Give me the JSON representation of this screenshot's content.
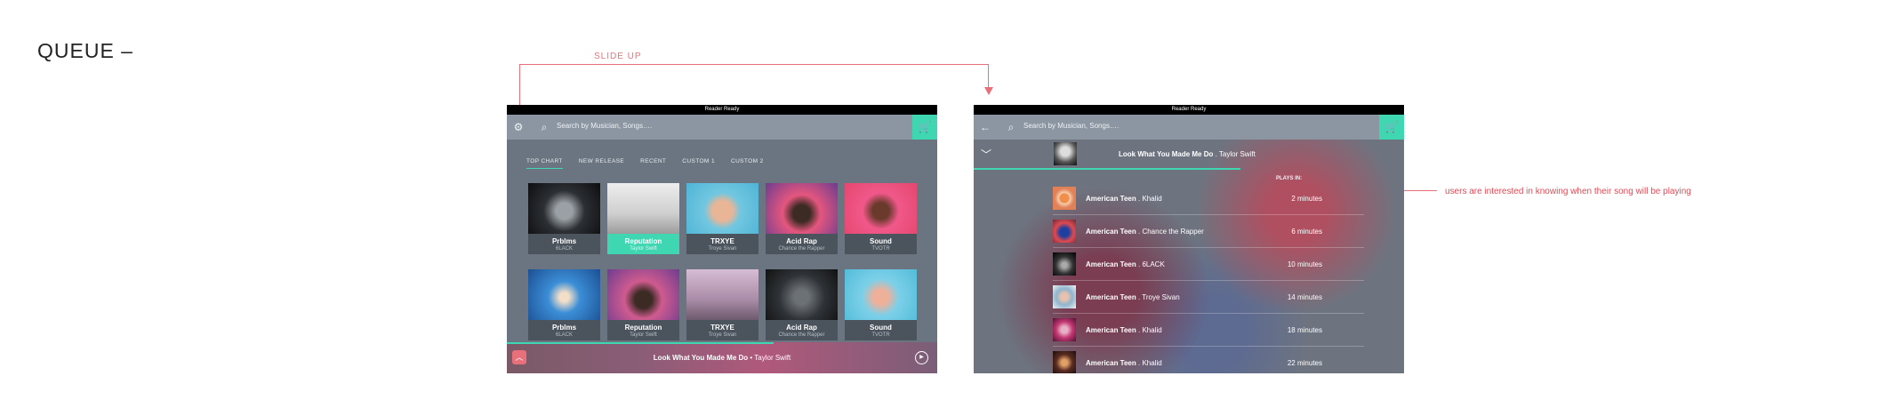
{
  "page": {
    "title": "QUEUE –"
  },
  "annotations": {
    "slide_up": "SLIDE UP",
    "note": "users are interested in knowing when their song will be playing"
  },
  "colors": {
    "accent": "#3fd6b2",
    "annotation": "#e8707a",
    "screen_bg": "#6b7581"
  },
  "left_screen": {
    "status": "Reader Ready",
    "search_placeholder": "Search by Musician, Songs….",
    "icons": {
      "settings": "gear-icon",
      "search": "search-icon",
      "cart": "cart-icon"
    },
    "tabs": [
      {
        "label": "TOP CHART",
        "active": true
      },
      {
        "label": "NEW RELEASE"
      },
      {
        "label": "RECENT"
      },
      {
        "label": "CUSTOM 1"
      },
      {
        "label": "CUSTOM 2"
      }
    ],
    "albums": [
      {
        "title": "Prblms",
        "artist": "6LACK"
      },
      {
        "title": "Reputation",
        "artist": "Taylor Swift",
        "selected": true
      },
      {
        "title": "TRXYE",
        "artist": "Troye Sivan"
      },
      {
        "title": "Acid Rap",
        "artist": "Chance the Rapper"
      },
      {
        "title": "Sound",
        "artist": "TVOTR"
      },
      {
        "title": "Prblms",
        "artist": "6LACK"
      },
      {
        "title": "Reputation",
        "artist": "Taylor Swift"
      },
      {
        "title": "TRXYE",
        "artist": "Troye Sivan"
      },
      {
        "title": "Acid Rap",
        "artist": "Chance the Rapper"
      },
      {
        "title": "Sound",
        "artist": "TVOTR"
      }
    ],
    "now_playing": {
      "song": "Look What You Made Me Do",
      "separator": " • ",
      "artist": "Taylor Swift"
    }
  },
  "right_screen": {
    "status": "Reader Ready",
    "search_placeholder": "Search by Musician, Songs….",
    "now_playing": {
      "song": "Look What You Made Me Do",
      "separator": " . ",
      "artist": "Taylor Swift"
    },
    "plays_in_label": "PLAYS IN:",
    "queue": [
      {
        "song": "American Teen",
        "artist": "Khalid",
        "time": "2 minutes"
      },
      {
        "song": "American Teen",
        "artist": "Chance the Rapper",
        "time": "6 minutes"
      },
      {
        "song": "American Teen",
        "artist": "6LACK",
        "time": "10 minutes"
      },
      {
        "song": "American Teen",
        "artist": "Troye Sivan",
        "time": "14 minutes"
      },
      {
        "song": "American Teen",
        "artist": "Khalid",
        "time": "18 minutes"
      },
      {
        "song": "American Teen",
        "artist": "Khalid",
        "time": "22 minutes"
      }
    ]
  }
}
